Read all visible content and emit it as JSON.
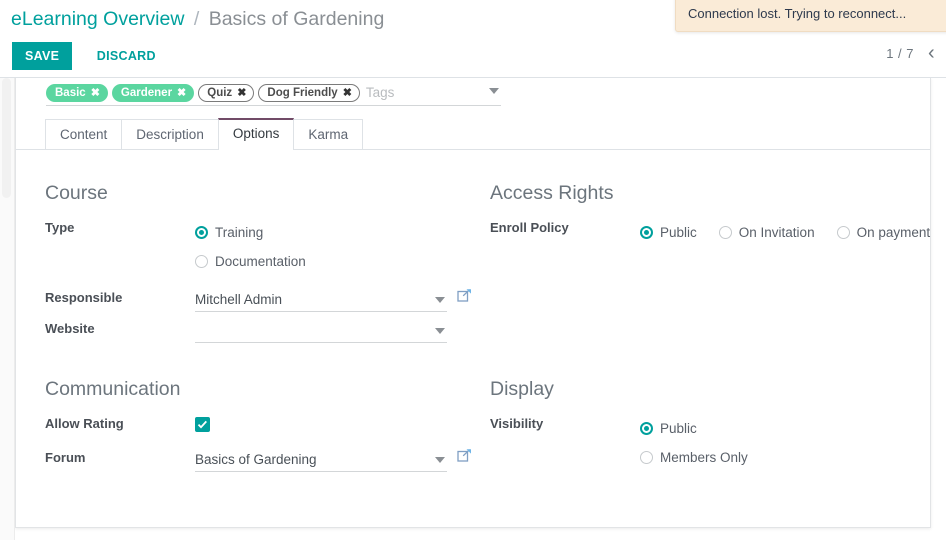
{
  "breadcrumb": {
    "parent": "eLearning Overview",
    "separator": "/",
    "current": "Basics of Gardening"
  },
  "buttons": {
    "save": "SAVE",
    "discard": "DISCARD"
  },
  "pager": {
    "count": "1 / 7",
    "prev_icon": "chevron-left-icon",
    "prev_glyph": "‹"
  },
  "notification": {
    "message": "Connection lost. Trying to reconnect..."
  },
  "tags_field": {
    "placeholder": "Tags",
    "tags": [
      {
        "label": "Basic",
        "style": "green",
        "remove": "✖"
      },
      {
        "label": "Gardener",
        "style": "green",
        "remove": "✖"
      },
      {
        "label": "Quiz",
        "style": "plain",
        "remove": "✖"
      },
      {
        "label": "Dog Friendly",
        "style": "plain",
        "remove": "✖"
      }
    ]
  },
  "tabs": [
    {
      "label": "Content",
      "active": false
    },
    {
      "label": "Description",
      "active": false
    },
    {
      "label": "Options",
      "active": true
    },
    {
      "label": "Karma",
      "active": false
    }
  ],
  "course": {
    "title": "Course",
    "type_label": "Type",
    "type_options": [
      {
        "label": "Training",
        "selected": true
      },
      {
        "label": "Documentation",
        "selected": false
      }
    ],
    "responsible_label": "Responsible",
    "responsible_value": "Mitchell Admin",
    "website_label": "Website",
    "website_value": ""
  },
  "access_rights": {
    "title": "Access Rights",
    "enroll_policy_label": "Enroll Policy",
    "enroll_options": [
      {
        "label": "Public",
        "selected": true
      },
      {
        "label": "On Invitation",
        "selected": false
      },
      {
        "label": "On payment",
        "selected": false
      }
    ]
  },
  "communication": {
    "title": "Communication",
    "allow_rating_label": "Allow Rating",
    "allow_rating_checked": true,
    "forum_label": "Forum",
    "forum_value": "Basics of Gardening"
  },
  "display": {
    "title": "Display",
    "visibility_label": "Visibility",
    "visibility_options": [
      {
        "label": "Public",
        "selected": true
      },
      {
        "label": "Members Only",
        "selected": false
      }
    ]
  },
  "colors": {
    "accent": "#00A09D",
    "tab_active": "#714B67",
    "tag_green": "#5bd6a0",
    "toast_bg": "#FAEBD7"
  }
}
